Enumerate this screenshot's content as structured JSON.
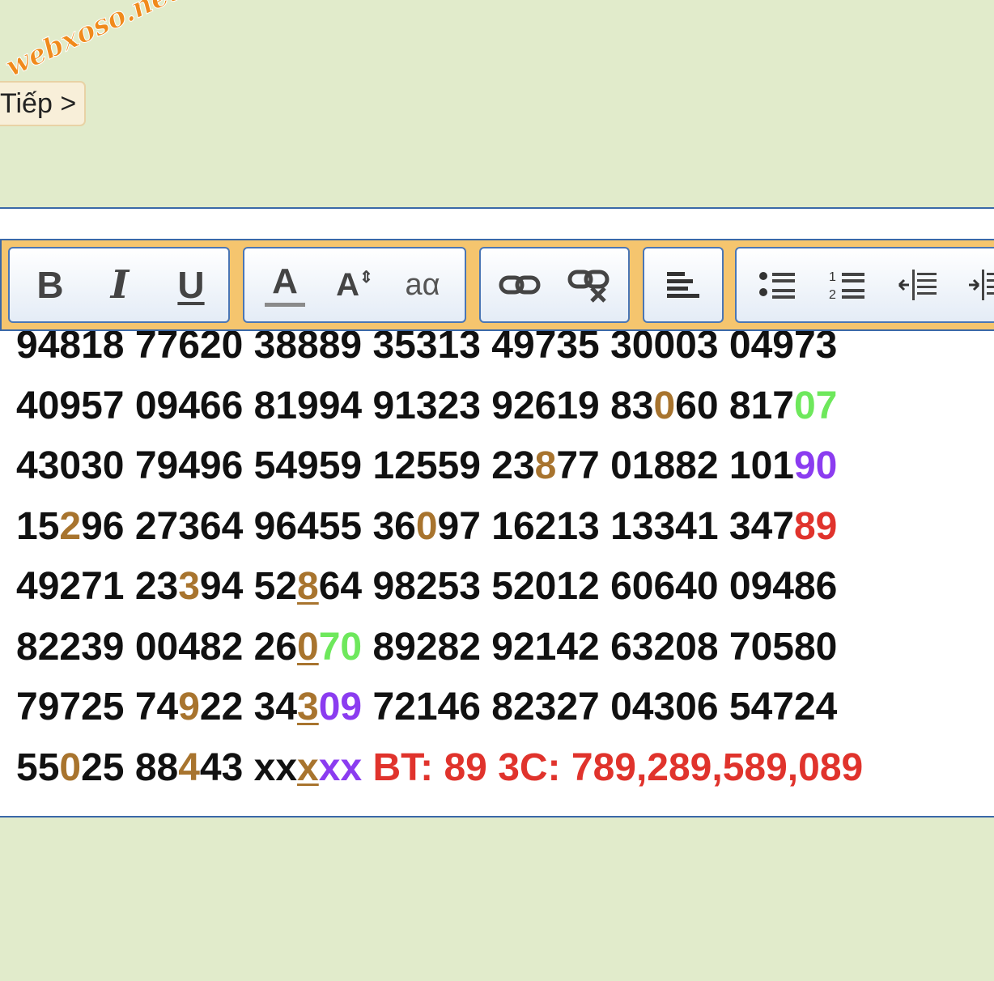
{
  "watermark": {
    "text": "webxoso.net"
  },
  "nav": {
    "next_label": "Tiếp >"
  },
  "toolbar": {
    "icons": [
      "bold-icon",
      "italic-icon",
      "underline-icon",
      "font-color-icon",
      "font-size-icon",
      "text-case-icon",
      "link-icon",
      "unlink-icon",
      "align-left-icon",
      "bullet-list-icon",
      "numbered-list-icon",
      "outdent-icon",
      "indent-icon"
    ],
    "bold_label": "B",
    "italic_label": "I",
    "underline_label": "U",
    "font_color_label": "A",
    "font_size_label": "A",
    "text_case_label": "aα"
  },
  "colors": {
    "brown": "#a8742e",
    "green": "#6ee85c",
    "purple": "#8b3cf0",
    "red": "#e0332c",
    "black": "#111111"
  },
  "rows": [
    [
      {
        "t": "94818 77620 38889 35313 49735 30003 04973",
        "c": "black"
      }
    ],
    [
      {
        "t": "40957 09466 81994 91323 92619 83",
        "c": "black"
      },
      {
        "t": "0",
        "c": "brown"
      },
      {
        "t": "60 817",
        "c": "black"
      },
      {
        "t": "07",
        "c": "green"
      }
    ],
    [
      {
        "t": "43030 79496 54959 12559 23",
        "c": "black"
      },
      {
        "t": "8",
        "c": "brown"
      },
      {
        "t": "77 01882 101",
        "c": "black"
      },
      {
        "t": "90",
        "c": "purple"
      }
    ],
    [
      {
        "t": "15",
        "c": "black"
      },
      {
        "t": "2",
        "c": "brown"
      },
      {
        "t": "96 27364 96455 36",
        "c": "black"
      },
      {
        "t": "0",
        "c": "brown"
      },
      {
        "t": "97 16213 13341 347",
        "c": "black"
      },
      {
        "t": "89",
        "c": "red"
      }
    ],
    [
      {
        "t": "49271 23",
        "c": "black"
      },
      {
        "t": "3",
        "c": "brown"
      },
      {
        "t": "94 52",
        "c": "black"
      },
      {
        "t": "8",
        "c": "brown",
        "u": true
      },
      {
        "t": "64 98253 52012 60640 09486",
        "c": "black"
      }
    ],
    [
      {
        "t": "82239 00482 26",
        "c": "black"
      },
      {
        "t": "0",
        "c": "brown",
        "u": true
      },
      {
        "t": "70",
        "c": "green"
      },
      {
        "t": " 89282 92142 63208 70580",
        "c": "black"
      }
    ],
    [
      {
        "t": "79725 74",
        "c": "black"
      },
      {
        "t": "9",
        "c": "brown"
      },
      {
        "t": "22 34",
        "c": "black"
      },
      {
        "t": "3",
        "c": "brown",
        "u": true
      },
      {
        "t": "09",
        "c": "purple"
      },
      {
        "t": " 72146 82327 04306 54724",
        "c": "black"
      }
    ],
    [
      {
        "t": "55",
        "c": "black"
      },
      {
        "t": "0",
        "c": "brown"
      },
      {
        "t": "25 88",
        "c": "black"
      },
      {
        "t": "4",
        "c": "brown"
      },
      {
        "t": "43 xx",
        "c": "black"
      },
      {
        "t": "x",
        "c": "brown",
        "u": true
      },
      {
        "t": "xx",
        "c": "purple"
      },
      {
        "t": " BT: 89 3C: 789,289,589,089",
        "c": "red"
      }
    ]
  ]
}
